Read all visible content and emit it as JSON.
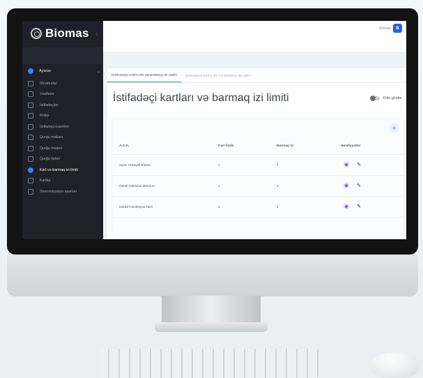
{
  "app": {
    "name": "Biomas",
    "user_name": "Biomas",
    "user_initial": "B"
  },
  "sidebar": {
    "group_label": "Ayarlar",
    "items": [
      {
        "label": "Strukturlar",
        "icon": "org-icon"
      },
      {
        "label": "Vəzifələr",
        "icon": "position-icon"
      },
      {
        "label": "İstifadəçilər",
        "icon": "users-icon"
      },
      {
        "label": "Rollar",
        "icon": "roles-icon"
      },
      {
        "label": "İstifadəçi icazələri",
        "icon": "permissions-icon"
      },
      {
        "label": "Qurğu məkanı",
        "icon": "location-icon"
      },
      {
        "label": "Qurğu modeli",
        "icon": "device-model-icon"
      },
      {
        "label": "Qurğu tipləri",
        "icon": "device-type-icon"
      },
      {
        "label": "Kart və barmaq izi limiti",
        "icon": "fingerprint-icon",
        "active": true
      },
      {
        "label": "Kartlar",
        "icon": "cards-icon"
      },
      {
        "label": "Sinxronizasiya ayarları",
        "icon": "sync-icon"
      }
    ]
  },
  "tabs": [
    {
      "label": "İSTİFADƏÇİ KARTLARI VƏ BARMAQ İZİ LİMİTİ",
      "active": true
    },
    {
      "label": "BARKODAŞ KARTLARI VƏ BARMAQ İZİ LİMİTİ",
      "active": false
    }
  ],
  "page": {
    "title": "İstifadəçi kartları və barmaq izi limiti",
    "filter_label": "Filtri göstər"
  },
  "table": {
    "headers": [
      "A.S.A.",
      "Kart limiti",
      "Barmaq izi",
      "Əməliyyatlar"
    ],
    "rows": [
      {
        "name": "Aytac Hüseynli Elnarə",
        "card_limit": "1",
        "finger_limit": "4"
      },
      {
        "name": "Günel Səlimova Mehman",
        "card_limit": "1",
        "finger_limit": "4"
      },
      {
        "name": "Murad Həsəbəyov Tacir",
        "card_limit": "1",
        "finger_limit": "4"
      }
    ]
  },
  "colors": {
    "accent": "#3b82f6",
    "sidebar_bg": "#1f2029",
    "eye": "#7c3aed"
  }
}
